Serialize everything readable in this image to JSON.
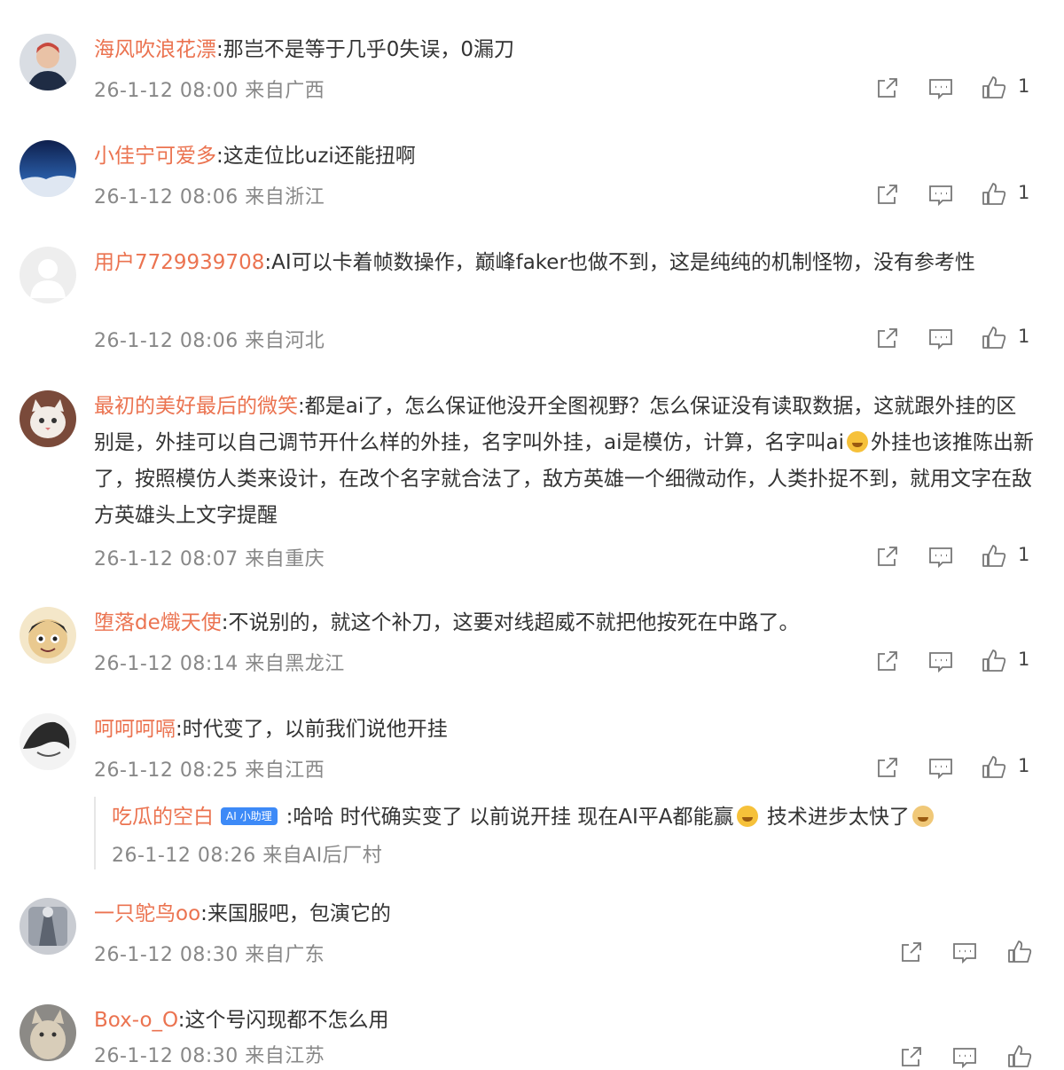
{
  "comments": [
    {
      "name": "海风吹浪花漂",
      "text": ":那岂不是等于几乎0失误，0漏刀",
      "meta": "26-1-12 08:00 来自广西",
      "likes": "1"
    },
    {
      "name": "小佳宁可爱多",
      "text": ":这走位比uzi还能扭啊",
      "meta": "26-1-12 08:06 来自浙江",
      "likes": "1"
    },
    {
      "name": "用户7729939708",
      "text": ":AI可以卡着帧数操作，巅峰faker也做不到，这是纯纯的机制怪物，没有参考性",
      "meta": "26-1-12 08:06 来自河北",
      "likes": "1"
    },
    {
      "name": "最初的美好最后的微笑",
      "text": ":都是ai了，怎么保证他没开全图视野？怎么保证没有读取数据，这就跟外挂的区别是，外挂可以自己调节开什么样的外挂，名字叫外挂，ai是模仿，计算，名字叫ai",
      "text2": "外挂也该推陈出新了，按照模仿人类来设计，在改个名字就合法了，敌方英雄一个细微动作，人类扑捉不到，就用文字在敌方英雄头上文字提醒",
      "meta": "26-1-12 08:07 来自重庆",
      "likes": "1"
    },
    {
      "name": "堕落de熾天使",
      "text": ":不说别的，就这个补刀，这要对线超威不就把他按死在中路了。",
      "meta": "26-1-12 08:14 来自黑龙江",
      "likes": "1"
    },
    {
      "name": "呵呵呵嗝",
      "text": ":时代变了，以前我们说他开挂",
      "meta": "26-1-12 08:25 来自江西",
      "likes": "1"
    },
    {
      "name": "一只鸵鸟oo",
      "text": ":来国服吧，包演它的",
      "meta": "26-1-12 08:30 来自广东",
      "likes": ""
    },
    {
      "name": "Box-o_O",
      "text": ":这个号闪现都不怎么用",
      "meta": "26-1-12 08:30 来自江苏",
      "likes": ""
    }
  ],
  "reply": {
    "name": "吃瓜的空白",
    "badge": "AI 小助理",
    "text_a": ":哈哈 时代确实变了 以前说开挂 现在AI平A都能赢",
    "text_b": " 技术进步太快了",
    "meta": "26-1-12 08:26 来自AI后厂村"
  },
  "colors": {
    "name": "#eb7350",
    "meta": "#888888",
    "text": "#333333",
    "badge": "#3d8af7"
  },
  "icons": [
    "share-icon",
    "comment-icon",
    "like-icon"
  ]
}
